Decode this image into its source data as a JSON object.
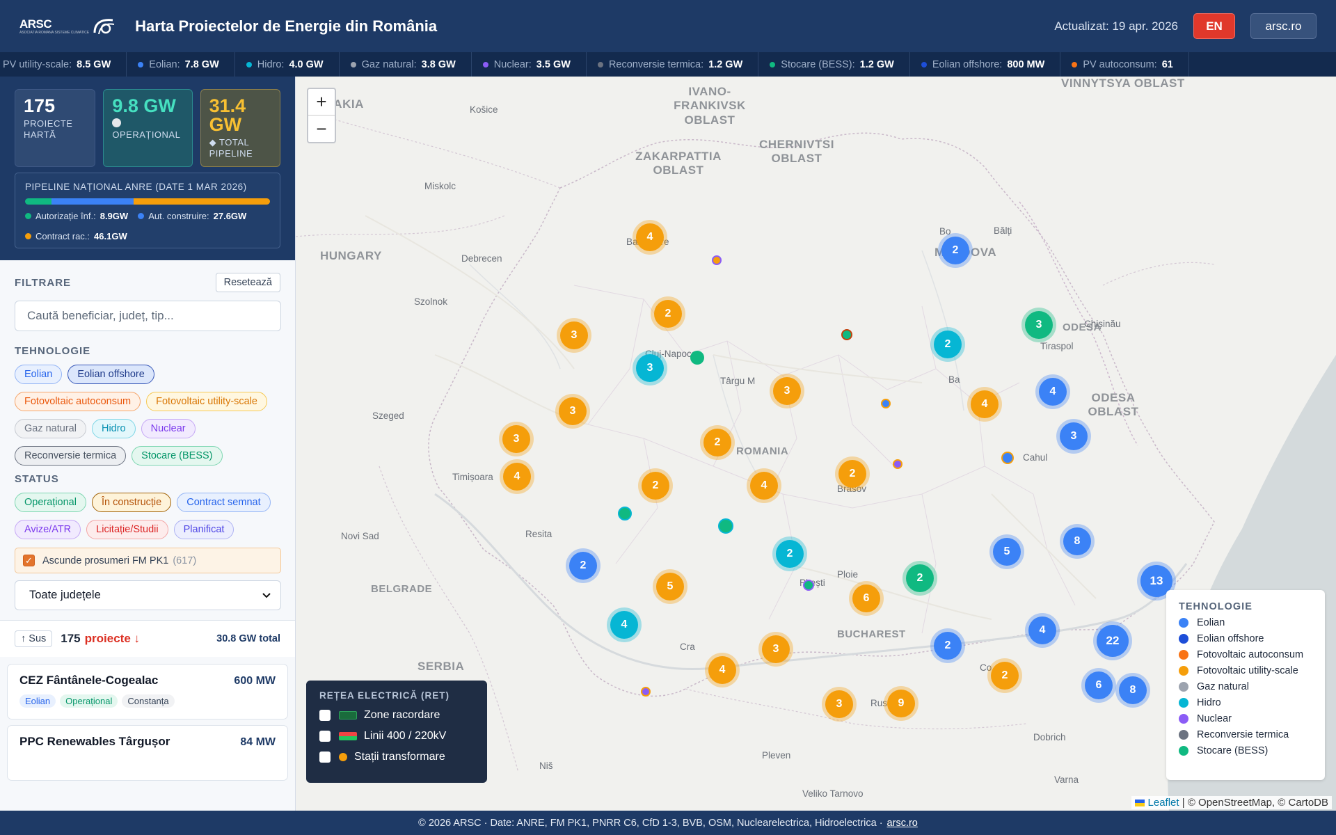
{
  "header": {
    "logo_text": "ARSC",
    "logo_tagline": "ASOCIATIA ROMANA SISTEME CLIMATICE",
    "title": "Harta Proiectelor de Energie din România",
    "updated": "Actualizat: 19 apr. 2026",
    "lang_button": "EN",
    "site_button": "arsc.ro"
  },
  "ticker": [
    {
      "label": "PV utility-scale:",
      "value": "8.5 GW",
      "color": "#f59e0b"
    },
    {
      "label": "Eolian:",
      "value": "7.8 GW",
      "color": "#3b82f6"
    },
    {
      "label": "Hidro:",
      "value": "4.0 GW",
      "color": "#06b6d4"
    },
    {
      "label": "Gaz natural:",
      "value": "3.8 GW",
      "color": "#9ca3af"
    },
    {
      "label": "Nuclear:",
      "value": "3.5 GW",
      "color": "#8b5cf6"
    },
    {
      "label": "Reconversie termica:",
      "value": "1.2 GW",
      "color": "#6b7280"
    },
    {
      "label": "Stocare (BESS):",
      "value": "1.2 GW",
      "color": "#10b981"
    },
    {
      "label": "Eolian offshore:",
      "value": "800 MW",
      "color": "#1d4ed8"
    },
    {
      "label": "PV autoconsum:",
      "value": "61",
      "color": "#f97316"
    }
  ],
  "stats": {
    "projects_value": "175",
    "projects_label": "PROIECTE HARTĂ",
    "operational_value": "9.8 GW",
    "operational_label": "OPERAȚIONAL",
    "pipeline_value": "31.4 GW",
    "pipeline_label": "TOTAL PIPELINE",
    "pipeline_icon": "diamond-icon",
    "operational_icon": "circle-icon"
  },
  "anre": {
    "title": "PIPELINE NAȚIONAL ANRE (DATE 1 MAR 2026)",
    "items": [
      {
        "label": "Autorizație înf.:",
        "value": "8.9GW",
        "color": "#10b981",
        "gw": 8.9
      },
      {
        "label": "Aut. construire:",
        "value": "27.6GW",
        "color": "#3b82f6",
        "gw": 27.6
      },
      {
        "label": "Contract rac.:",
        "value": "46.1GW",
        "color": "#f59e0b",
        "gw": 46.1
      }
    ]
  },
  "filters": {
    "title": "FILTRARE",
    "reset": "Resetează",
    "search_placeholder": "Caută beneficiar, județ, tip...",
    "tech_title": "TEHNOLOGIE",
    "tech_chips": [
      {
        "label": "Eolian",
        "color": "#2563eb",
        "bg": "#e8f0fe",
        "border": "#93b4f5"
      },
      {
        "label": "Eolian offshore",
        "color": "#1e3a8a",
        "bg": "#dbe6fb",
        "border": "#3757b8"
      },
      {
        "label": "Fotovoltaic autoconsum",
        "color": "#ea580c",
        "bg": "#fff1e6",
        "border": "#f5a56b"
      },
      {
        "label": "Fotovoltaic utility-scale",
        "color": "#d97706",
        "bg": "#fff7e0",
        "border": "#f5c955"
      },
      {
        "label": "Gaz natural",
        "color": "#6b7280",
        "bg": "#f1f2f4",
        "border": "#c6cad1"
      },
      {
        "label": "Hidro",
        "color": "#0891b2",
        "bg": "#e3f7fb",
        "border": "#7fd6e6"
      },
      {
        "label": "Nuclear",
        "color": "#7c3aed",
        "bg": "#f1eafe",
        "border": "#c5a8f5"
      },
      {
        "label": "Reconversie termica",
        "color": "#4b5563",
        "bg": "#eceef1",
        "border": "#6b7280"
      },
      {
        "label": "Stocare (BESS)",
        "color": "#059669",
        "bg": "#e4f7ef",
        "border": "#7dd6b1"
      }
    ],
    "status_title": "STATUS",
    "status_chips": [
      {
        "label": "Operațional",
        "color": "#059669",
        "bg": "#e4f7ef",
        "border": "#7dd6b1"
      },
      {
        "label": "În construcție",
        "color": "#b45309",
        "bg": "#fef3d9",
        "border": "#a16207"
      },
      {
        "label": "Contract semnat",
        "color": "#2563eb",
        "bg": "#e8f0fe",
        "border": "#93b4f5"
      },
      {
        "label": "Avize/ATR",
        "color": "#7c3aed",
        "bg": "#f1eafe",
        "border": "#c5a8f5"
      },
      {
        "label": "Licitație/Studii",
        "color": "#dc2626",
        "bg": "#fdecec",
        "border": "#f3a6a6"
      },
      {
        "label": "Planificat",
        "color": "#4f46e5",
        "bg": "#eceefe",
        "border": "#aeb3f3"
      }
    ],
    "prosumer_label": "Ascunde prosumeri FM PK1",
    "prosumer_count": "(617)",
    "county_select": "Toate județele"
  },
  "list": {
    "up_button": "↑ Sus",
    "count": "175",
    "word": "proiecte ↓",
    "total": "30.8 GW total",
    "projects": [
      {
        "name": "CEZ Fântânele-Cogealac",
        "power": "600 MW",
        "tags": [
          {
            "label": "Eolian",
            "color": "#2563eb",
            "bg": "#e8f0fe"
          },
          {
            "label": "Operațional",
            "color": "#059669",
            "bg": "#e4f7ef"
          },
          {
            "label": "Constanța",
            "color": "#334155",
            "bg": "#f1f2f4"
          }
        ]
      },
      {
        "name": "PPC Renewables Târgușor",
        "power": "84 MW",
        "tags": []
      }
    ]
  },
  "map": {
    "zoom_in": "+",
    "zoom_out": "−",
    "region_labels": [
      "OVAKIA",
      "IVANO-FRANKIVSK OBLAST",
      "VINNYTSYA OBLAST",
      "ZAKARPATTIA OBLAST",
      "CHERNIVTSI OBLAST",
      "HUNGARY",
      "MOLDOVA",
      "ROMANIA",
      "ODESA OBLAST",
      "BELGRADE",
      "SERBIA",
      "BUCHAREST",
      "ODESA"
    ],
    "cities": [
      "Košice",
      "Miskolc",
      "Baia Mare",
      "Debrecen",
      "Bălți",
      "Szolnok",
      "Chișinău",
      "Tiraspol",
      "Cluj-Napoca",
      "Târgu M",
      "Szeged",
      "Timișoara",
      "Cahul",
      "Brasov",
      "Novi Sad",
      "Resita",
      "Pitești",
      "Ploie",
      "Niš",
      "Pleven",
      "Dobrich",
      "Varna",
      "Veliko Tarnovo",
      "Cra",
      "Bo",
      "Ba",
      "Co",
      "Rus"
    ],
    "clusters": [
      {
        "n": "4",
        "type": "pv"
      },
      {
        "n": "2",
        "type": "wind"
      },
      {
        "n": "2",
        "type": "pv"
      },
      {
        "n": "3",
        "type": "bess"
      },
      {
        "n": "3",
        "type": "pv"
      },
      {
        "n": "2",
        "type": "hydro"
      },
      {
        "n": "3",
        "type": "hydro"
      },
      {
        "n": "3",
        "type": "pv"
      },
      {
        "n": "4",
        "type": "pv"
      },
      {
        "n": "4",
        "type": "wind"
      },
      {
        "n": "3",
        "type": "pv"
      },
      {
        "n": "3",
        "type": "wind"
      },
      {
        "n": "3",
        "type": "pv"
      },
      {
        "n": "2",
        "type": "pv"
      },
      {
        "n": "4",
        "type": "pv"
      },
      {
        "n": "2",
        "type": "pv"
      },
      {
        "n": "4",
        "type": "pv"
      },
      {
        "n": "2",
        "type": "pv"
      },
      {
        "n": "2",
        "type": "wind"
      },
      {
        "n": "2",
        "type": "hydro"
      },
      {
        "n": "5",
        "type": "wind"
      },
      {
        "n": "8",
        "type": "wind"
      },
      {
        "n": "5",
        "type": "pv"
      },
      {
        "n": "6",
        "type": "pv"
      },
      {
        "n": "2",
        "type": "bess"
      },
      {
        "n": "13",
        "type": "wind"
      },
      {
        "n": "4",
        "type": "hydro"
      },
      {
        "n": "4",
        "type": "wind"
      },
      {
        "n": "22",
        "type": "wind"
      },
      {
        "n": "3",
        "type": "pv"
      },
      {
        "n": "2",
        "type": "wind"
      },
      {
        "n": "4",
        "type": "pv"
      },
      {
        "n": "2",
        "type": "pv"
      },
      {
        "n": "3",
        "type": "pv"
      },
      {
        "n": "9",
        "type": "pv"
      },
      {
        "n": "6",
        "type": "wind"
      },
      {
        "n": "8",
        "type": "wind"
      }
    ],
    "ret": {
      "title": "REȚEA ELECTRICĂ (RET)",
      "items": [
        "Zone racordare",
        "Linii 400 / 220kV",
        "Stații transformare"
      ]
    },
    "legend": {
      "title": "TEHNOLOGIE",
      "items": [
        {
          "label": "Eolian",
          "color": "#3b82f6"
        },
        {
          "label": "Eolian offshore",
          "color": "#1d4ed8"
        },
        {
          "label": "Fotovoltaic autoconsum",
          "color": "#f97316"
        },
        {
          "label": "Fotovoltaic utility-scale",
          "color": "#f59e0b"
        },
        {
          "label": "Gaz natural",
          "color": "#9ca3af"
        },
        {
          "label": "Hidro",
          "color": "#06b6d4"
        },
        {
          "label": "Nuclear",
          "color": "#8b5cf6"
        },
        {
          "label": "Reconversie termica",
          "color": "#6b7280"
        },
        {
          "label": "Stocare (BESS)",
          "color": "#10b981"
        }
      ]
    },
    "attribution": {
      "leaflet": "Leaflet",
      "rest": "| © OpenStreetMap, © CartoDB"
    }
  },
  "footer": {
    "text": "© 2026 ARSC  ·  Date: ANRE, FM PK1, PNRR C6, CfD 1-3, BVB, OSM, Nuclearelectrica, Hidroelectrica  ·",
    "link": "arsc.ro"
  },
  "colors": {
    "wind": "#3b82f6",
    "pv": "#f59e0b",
    "hydro": "#06b6d4",
    "bess": "#10b981",
    "nuclear": "#8b5cf6",
    "header_bg": "#1e3a66"
  }
}
